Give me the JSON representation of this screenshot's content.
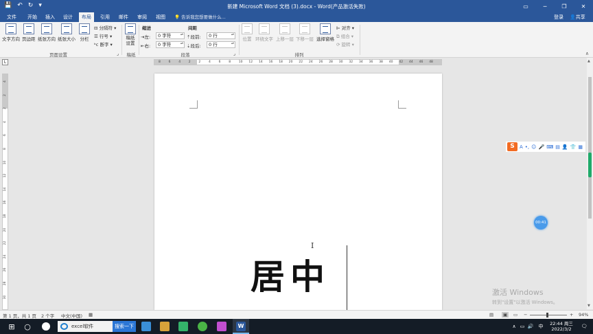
{
  "window": {
    "title": "新建 Microsoft Word 文档 (3).docx - Word(产品激活失败)",
    "qat_icons": [
      "save-icon",
      "undo-icon",
      "redo-icon",
      "customize-icon"
    ],
    "minimize_glyph": "─",
    "restore_glyph": "❐",
    "close_glyph": "✕"
  },
  "tabs": [
    "文件",
    "开始",
    "插入",
    "设计",
    "布局",
    "引用",
    "邮件",
    "审阅",
    "视图"
  ],
  "active_tab": "布局",
  "tell_me": "告诉我您想要做什么...",
  "account": {
    "login": "登录",
    "share": "共享"
  },
  "ribbon": {
    "page_setup": {
      "buttons": [
        "文字方向",
        "页边距",
        "纸张方向",
        "纸张大小",
        "分栏"
      ],
      "small": [
        "分隔符",
        "行号",
        "断字"
      ],
      "label": "页面设置"
    },
    "manuscript": {
      "button": "稿纸设置",
      "label": "稿纸"
    },
    "paragraph": {
      "indent_header": "缩进",
      "indent_left_label": "左:",
      "indent_left_value": "0 字符",
      "indent_right_label": "右:",
      "indent_right_value": "0 字符",
      "spacing_header": "间距",
      "spacing_before_label": "段前:",
      "spacing_before_value": "0 行",
      "spacing_after_label": "段后:",
      "spacing_after_value": "0 行",
      "label": "段落"
    },
    "arrange": {
      "buttons": [
        "位置",
        "环绕文字",
        "上移一层",
        "下移一层",
        "选择窗格"
      ],
      "small": [
        "对齐",
        "组合",
        "旋转"
      ],
      "label": "排列"
    }
  },
  "ruler": {
    "h_ticks": [
      "8",
      "6",
      "4",
      "2",
      "2",
      "4",
      "6",
      "8",
      "10",
      "12",
      "14",
      "16",
      "18",
      "20",
      "22",
      "24",
      "26",
      "28",
      "30",
      "32",
      "34",
      "36",
      "38",
      "40",
      "42",
      "44",
      "46",
      "48"
    ],
    "v_ticks": [
      "4",
      "2",
      "2",
      "4",
      "6",
      "8",
      "10",
      "12",
      "14",
      "16",
      "18",
      "20",
      "22",
      "24",
      "26",
      "28",
      "30"
    ]
  },
  "document": {
    "text": "居中"
  },
  "ime_toolbar": {
    "logo": "S",
    "items": [
      "A",
      "•,",
      "☺",
      "🎤",
      "⌨",
      "▤",
      "👤",
      "👕",
      "▦"
    ]
  },
  "timer": "00:41",
  "watermark": {
    "line1": "激活 Windows",
    "line2": "转到\"设置\"以激活 Windows。"
  },
  "status": {
    "page": "第 1 页，共 1 页",
    "words": "2 个字",
    "language": "中文(中国)",
    "zoom": "94%",
    "zoom_minus": "−",
    "zoom_plus": "+"
  },
  "taskbar": {
    "search_text": "excel软件",
    "search_button": "搜索一下",
    "time": "22:44 周三",
    "date": "2022/3/2",
    "input_method": "中",
    "tray_icons": [
      "chevron-up-icon",
      "network-icon",
      "volume-icon",
      "input-method-icon",
      "notification-icon"
    ]
  }
}
